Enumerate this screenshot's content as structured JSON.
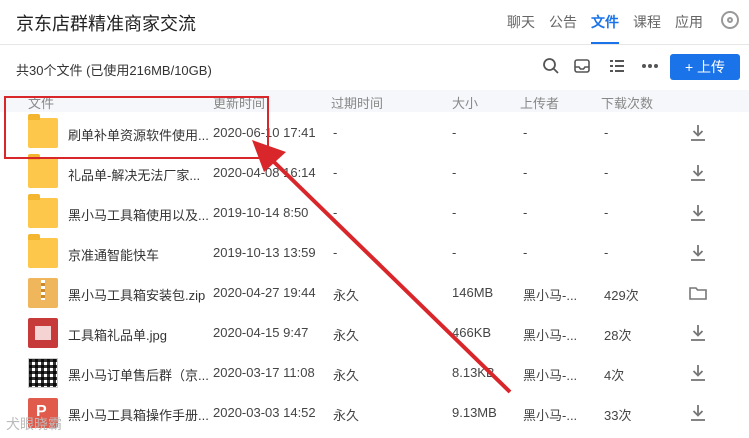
{
  "title": "京东店群精准商家交流",
  "tabs": [
    "聊天",
    "公告",
    "文件",
    "课程",
    "应用"
  ],
  "active_tab": "文件",
  "summary": "共30个文件 (已使用216MB/10GB)",
  "upload_label": "+ 上传",
  "columns": {
    "name": "文件",
    "time": "更新时间",
    "expire": "过期时间",
    "size": "大小",
    "uploader": "上传者",
    "downloads": "下载次数"
  },
  "files": [
    {
      "name": "刷单补单资源软件使用...",
      "time": "2020-06-10 17:41",
      "expire": "-",
      "size": "-",
      "uploader": "-",
      "downloads": "-",
      "type": "folder",
      "action": "download-icon"
    },
    {
      "name": "礼品单-解决无法厂家...",
      "time": "2020-04-08 16:14",
      "expire": "-",
      "size": "-",
      "uploader": "-",
      "downloads": "-",
      "type": "folder",
      "action": "download-icon"
    },
    {
      "name": "黑小马工具箱使用以及...",
      "time": "2019-10-14 8:50",
      "expire": "-",
      "size": "-",
      "uploader": "-",
      "downloads": "-",
      "type": "folder",
      "action": "download-icon"
    },
    {
      "name": "京准通智能快车",
      "time": "2019-10-13 13:59",
      "expire": "-",
      "size": "-",
      "uploader": "-",
      "downloads": "-",
      "type": "folder",
      "action": "download-icon"
    },
    {
      "name": "黑小马工具箱安装包.zip",
      "time": "2020-04-27 19:44",
      "expire": "永久",
      "size": "146MB",
      "uploader": "黑小马-...",
      "downloads": "429次",
      "type": "zip",
      "action": "open-folder-icon"
    },
    {
      "name": "工具箱礼品单.jpg",
      "time": "2020-04-15 9:47",
      "expire": "永久",
      "size": "466KB",
      "uploader": "黑小马-...",
      "downloads": "28次",
      "type": "jpg",
      "action": "download-icon"
    },
    {
      "name": "黑小马订单售后群（京...",
      "time": "2020-03-17 11:08",
      "expire": "永久",
      "size": "8.13KB",
      "uploader": "黑小马-...",
      "downloads": "4次",
      "type": "qr",
      "action": "download-icon"
    },
    {
      "name": "黑小马工具箱操作手册...",
      "time": "2020-03-03 14:52",
      "expire": "永久",
      "size": "9.13MB",
      "uploader": "黑小马-...",
      "downloads": "33次",
      "type": "ppt",
      "action": "download-icon"
    }
  ],
  "watermark": "犬眼晓霸",
  "colors": {
    "accent": "#1a73e8",
    "highlight": "#d9262a",
    "folder": "#fcc74a"
  }
}
